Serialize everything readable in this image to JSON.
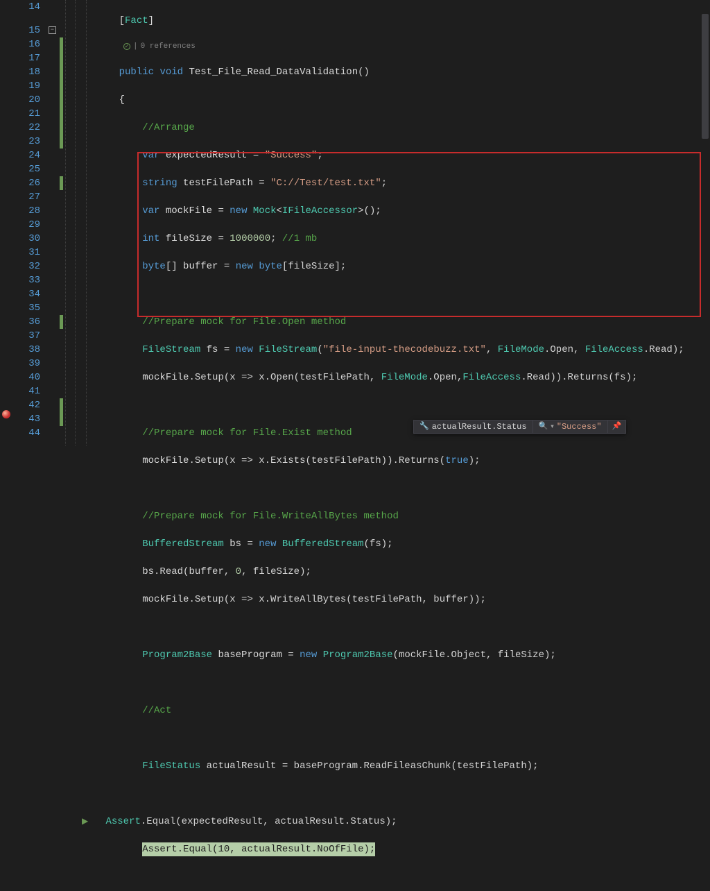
{
  "lines": [
    14,
    15,
    16,
    17,
    18,
    19,
    20,
    21,
    22,
    23,
    24,
    25,
    26,
    27,
    28,
    29,
    30,
    31,
    32,
    33,
    34,
    35,
    36,
    37,
    38,
    39,
    40,
    41,
    42,
    43,
    44
  ],
  "codelens": {
    "refs": "0 references"
  },
  "watch": {
    "expr": "actualResult.Status",
    "value": "\"Success\""
  },
  "code": {
    "l14": {
      "attr": "Fact"
    },
    "l15": {
      "kw_public": "public",
      "kw_void": "void",
      "method": "Test_File_Read_DataValidation"
    },
    "l16": {
      "brace": "{"
    },
    "l17": {
      "comment": "//Arrange"
    },
    "l18": {
      "kw_var": "var",
      "id": "expectedResult",
      "str": "\"Success\""
    },
    "l19": {
      "kw_string": "string",
      "id": "testFilePath",
      "str": "\"C://Test/test.txt\""
    },
    "l20": {
      "kw_var": "var",
      "id": "mockFile",
      "kw_new": "new",
      "type": "Mock",
      "gen": "IFileAccessor"
    },
    "l21": {
      "kw_int": "int",
      "id": "fileSize",
      "num": "1000000",
      "comment": "//1 mb"
    },
    "l22": {
      "kw_byte": "byte",
      "id": "buffer",
      "kw_new": "new",
      "kw_byte2": "byte"
    },
    "l24": {
      "comment": "//Prepare mock for File.Open method"
    },
    "l25": {
      "type": "FileStream",
      "id": "fs",
      "kw_new": "new",
      "type2": "FileStream",
      "str": "\"file-input-thecodebuzz.txt\"",
      "e1": "FileMode",
      "e1m": "Open",
      "e2": "FileAccess",
      "e2m": "Read"
    },
    "l26": {
      "id1": "mockFile",
      "m1": "Setup",
      "m2": "Open",
      "e1": "FileMode",
      "e1m": "Open",
      "e2": "FileAccess",
      "e2m": "Read",
      "m3": "Returns"
    },
    "l28": {
      "comment": "//Prepare mock for File.Exist method"
    },
    "l29": {
      "id1": "mockFile",
      "m1": "Setup",
      "m2": "Exists",
      "m3": "Returns",
      "kw_true": "true"
    },
    "l31": {
      "comment": "//Prepare mock for File.WriteAllBytes method"
    },
    "l32": {
      "type": "BufferedStream",
      "id": "bs",
      "kw_new": "new",
      "type2": "BufferedStream"
    },
    "l33": {
      "id": "bs",
      "m": "Read",
      "num": "0"
    },
    "l34": {
      "id1": "mockFile",
      "m1": "Setup",
      "m2": "WriteAllBytes"
    },
    "l36": {
      "type": "Program2Base",
      "id": "baseProgram",
      "kw_new": "new",
      "type2": "Program2Base"
    },
    "l38": {
      "comment": "//Act"
    },
    "l40": {
      "type": "FileStatus",
      "id": "actualResult",
      "m": "ReadFileasChunk"
    },
    "l42": {
      "type": "Assert",
      "m": "Equal"
    },
    "l43": {
      "type": "Assert",
      "m": "Equal",
      "num": "10",
      "prop": "NoOfFile"
    }
  }
}
